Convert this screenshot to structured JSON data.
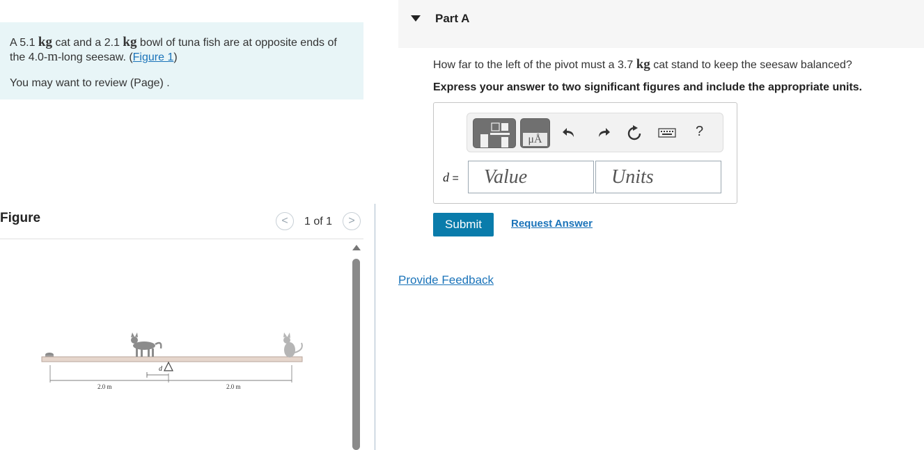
{
  "problem": {
    "intro_a": "A 5.1 ",
    "kg": "kg",
    "intro_b": " cat and a 2.1 ",
    "intro_c": " bowl of tuna fish are at opposite ends of the 4.0-",
    "m": "m",
    "intro_d": "-long seesaw. (",
    "figure_link": "Figure 1",
    "intro_e": ")",
    "review": "You may want to review (Page) ."
  },
  "figure": {
    "title": "Figure",
    "counter": "1 of 1",
    "prev_glyph": "<",
    "next_glyph": ">",
    "label_left": "2.0 m",
    "label_right": "2.0 m",
    "label_d": "d"
  },
  "part": {
    "title": "Part A",
    "question_a": "How far to the left of the pivot must a 3.7 ",
    "question_unit": "kg",
    "question_b": " cat stand to keep the seesaw balanced?",
    "instruction": "Express your answer to two significant figures and include the appropriate units."
  },
  "answer": {
    "variable": "d",
    "equals": " =",
    "value_placeholder": "Value",
    "units_placeholder": "Units",
    "toolbar": {
      "units_button": "μÅ",
      "help": "?"
    }
  },
  "actions": {
    "submit": "Submit",
    "request_answer": "Request Answer",
    "provide_feedback": "Provide Feedback"
  },
  "icons": {
    "templates": "fraction-template-icon",
    "units": "units-icon",
    "undo": "undo-icon",
    "redo": "redo-icon",
    "reset": "reset-icon",
    "keyboard": "keyboard-icon",
    "help": "help-icon"
  },
  "colors": {
    "problem_bg": "#e8f5f7",
    "link": "#1a73b9",
    "submit_bg": "#0a7cab"
  }
}
